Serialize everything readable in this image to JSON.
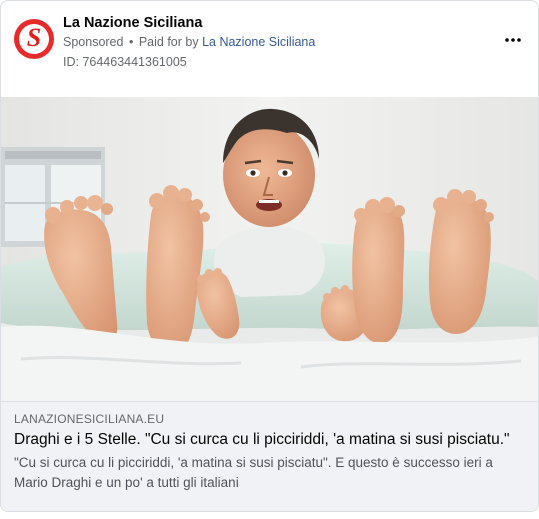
{
  "post": {
    "page_name": "La Nazione Siciliana",
    "avatar_letter": "S",
    "sponsored_label": "Sponsored",
    "separator": "•",
    "paid_for_prefix": "Paid for by",
    "paid_for_name": "La Nazione Siciliana",
    "ad_id": "ID: 764463441361005",
    "more_icon": "more-options-icon"
  },
  "colors": {
    "brand_red": "#ea2a2a",
    "link_box_bg": "#f0f2f5",
    "secondary_text": "#65676b"
  },
  "link_preview": {
    "domain": "LANAZIONESICILIANA.EU",
    "headline": "Draghi e i 5 Stelle. \"Cu si curca cu li picciriddi, 'a matina si susi pisciatu.\"",
    "description": "\"Cu si curca cu li picciriddi, 'a matina si susi pisciatu\". E questo è successo ieri a Mario Draghi e un po' a tutti gli italiani"
  }
}
